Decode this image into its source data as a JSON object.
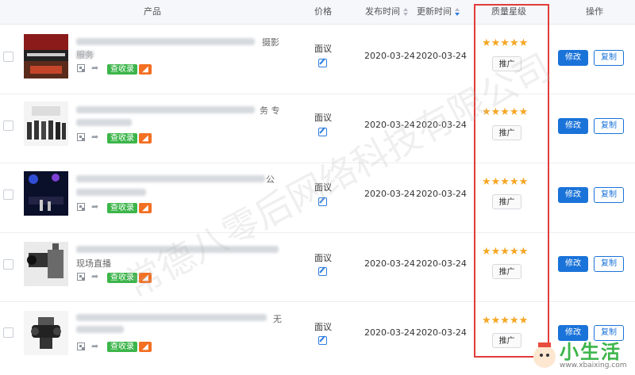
{
  "header": {
    "product": "产品",
    "price": "价格",
    "publish_time": "发布时间",
    "update_time": "更新时间",
    "quality": "质量星级",
    "actions": "操作"
  },
  "rows": [
    {
      "title_tail_1": "摄影",
      "title_tail_2": "服务",
      "price": "面议",
      "publish": "2020-03-24",
      "update": "2020-03-24",
      "stars": "★★★★★",
      "promote": "推广",
      "badge": "查收录",
      "edit": "修改",
      "copy": "复制"
    },
    {
      "title_tail_1": "务 专",
      "title_tail_2": "",
      "price": "面议",
      "publish": "2020-03-24",
      "update": "2020-03-24",
      "stars": "★★★★★",
      "promote": "推广",
      "badge": "查收录",
      "edit": "修改",
      "copy": "复制"
    },
    {
      "title_tail_1": "公",
      "title_tail_2": "",
      "price": "面议",
      "publish": "2020-03-24",
      "update": "2020-03-24",
      "stars": "★★★★★",
      "promote": "推广",
      "badge": "查收录",
      "edit": "修改",
      "copy": "复制"
    },
    {
      "title_tail_1": "",
      "title_tail_2": "现场直播",
      "price": "面议",
      "publish": "2020-03-24",
      "update": "2020-03-24",
      "stars": "★★★★★",
      "promote": "推广",
      "badge": "查收录",
      "edit": "修改",
      "copy": "复制"
    },
    {
      "title_tail_1": "无",
      "title_tail_2": "",
      "price": "面议",
      "publish": "2020-03-24",
      "update": "2020-03-24",
      "stars": "★★★★★",
      "promote": "推广",
      "badge": "查收录",
      "edit": "修改",
      "copy": "复制"
    }
  ],
  "watermark": "常德八零后网络科技有限公司",
  "site": {
    "title": "小生活",
    "url": "www.xbaixing.com"
  },
  "colors": {
    "accent": "#1a73d9",
    "star": "#f5a623",
    "badge_green": "#3cb54a",
    "highlight": "#e23b3b"
  }
}
